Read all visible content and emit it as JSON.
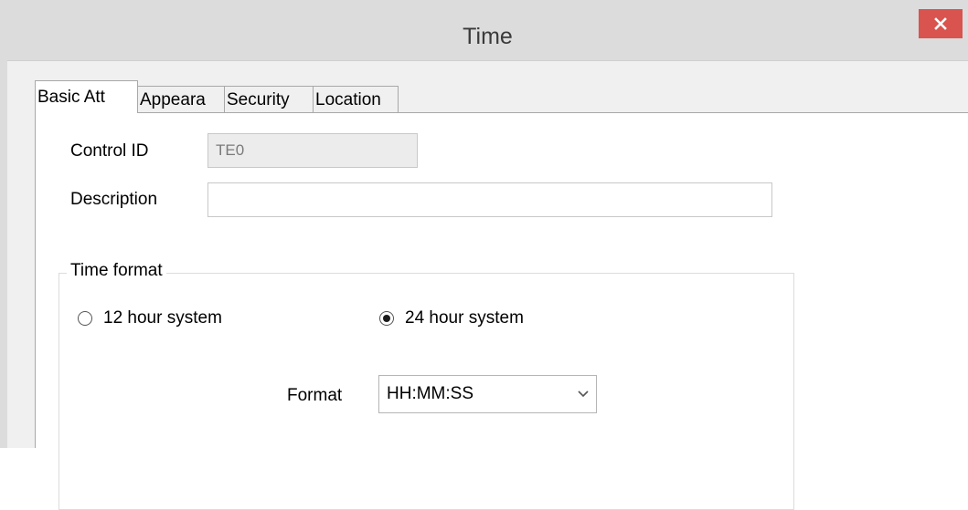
{
  "window": {
    "title": "Time",
    "close_icon": "close-icon"
  },
  "tabs": [
    {
      "label": "Basic Att",
      "active": true
    },
    {
      "label": "Appeara",
      "active": false
    },
    {
      "label": "Security",
      "active": false
    },
    {
      "label": "Location",
      "active": false
    }
  ],
  "basic": {
    "control_id_label": "Control ID",
    "control_id_value": "TE0",
    "description_label": "Description",
    "description_value": ""
  },
  "time_format": {
    "legend": "Time format",
    "option_12": "12 hour system",
    "option_24": "24 hour system",
    "selected": "24 hour system",
    "format_label": "Format",
    "format_value": "HH:MM:SS"
  },
  "colors": {
    "close_button": "#d9534f"
  }
}
